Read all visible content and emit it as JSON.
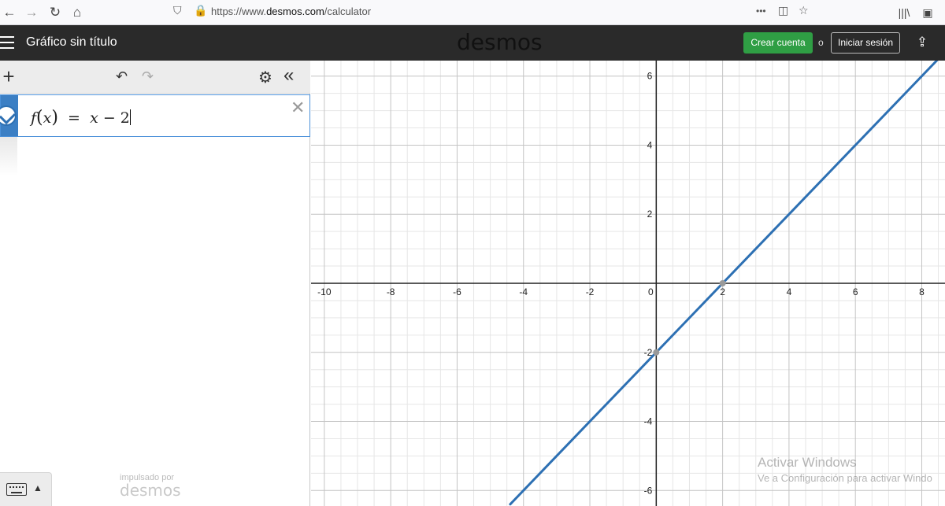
{
  "browser": {
    "url_prefix": "https://www.",
    "url_host": "desmos.com",
    "url_path": "/calculator",
    "more_label": "•••"
  },
  "header": {
    "title": "Gráfico sin título",
    "brand": "desmos",
    "create_account": "Crear cuenta",
    "or": "o",
    "login": "Iniciar sesión"
  },
  "expression": {
    "fname": "f",
    "arg": "x",
    "eq": "=",
    "var": "x",
    "op": "−",
    "const": "2",
    "color": "#2d70b3"
  },
  "footer": {
    "powered_by": "impulsado por",
    "brand": "desmos"
  },
  "graph": {
    "x_ticks": [
      "-10",
      "-8",
      "-6",
      "-4",
      "-2",
      "0",
      "2",
      "4",
      "6",
      "8"
    ],
    "y_ticks": [
      "6",
      "4",
      "2",
      "-2",
      "-4",
      "-6"
    ],
    "line_color": "#2d70b3"
  },
  "chart_data": {
    "type": "line",
    "series": [
      {
        "name": "f(x) = x − 2",
        "x": [
          -4.4,
          8.6
        ],
        "y": [
          -6.4,
          6.6
        ]
      }
    ],
    "xlim": [
      -10.4,
      8.7
    ],
    "ylim": [
      -6.45,
      6.45
    ],
    "x_ticks": [
      -10,
      -8,
      -6,
      -4,
      -2,
      0,
      2,
      4,
      6,
      8
    ],
    "y_ticks": [
      -6,
      -4,
      -2,
      2,
      4,
      6
    ],
    "points": [
      {
        "x": 2,
        "y": 0
      },
      {
        "x": 0,
        "y": -2
      }
    ],
    "grid": true
  },
  "watermark": {
    "line1": "Activar Windows",
    "line2": "Ve a Configuración para activar Windo"
  }
}
